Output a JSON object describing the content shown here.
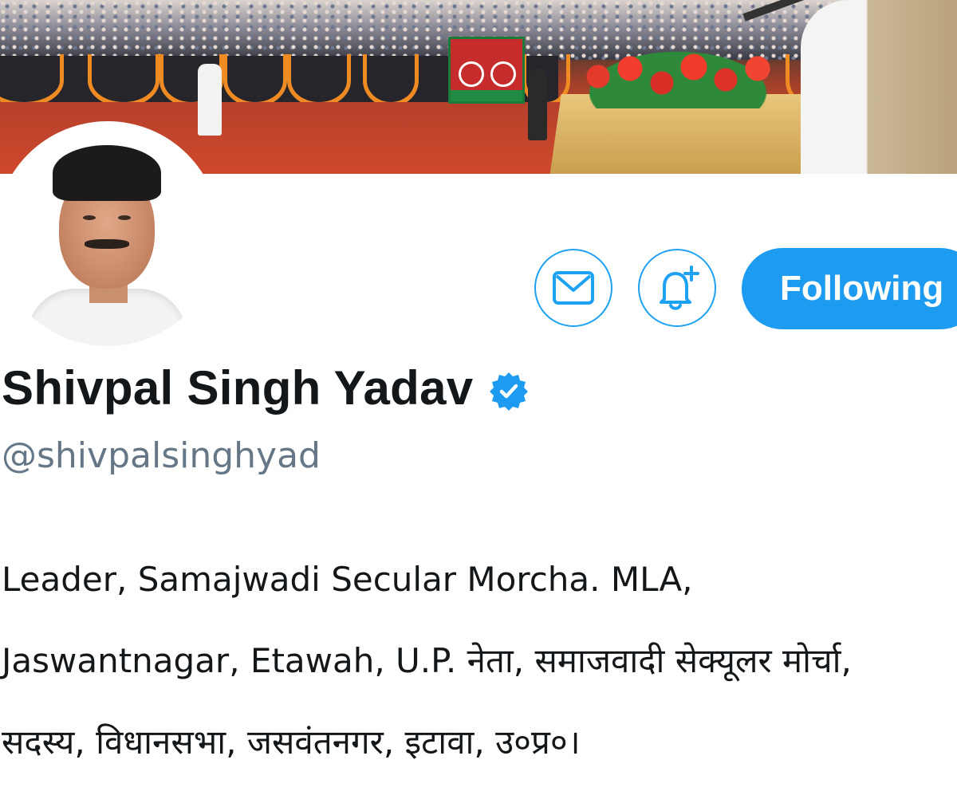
{
  "profile": {
    "name": "Shivpal Singh Yadav",
    "handle": "@shivpalsinghyad",
    "verified": true,
    "bio_lines": [
      "Leader, Samajwadi Secular Morcha. MLA,",
      "Jaswantnagar, Etawah, U.P.  नेता, समाजवादी सेक्यूलर मोर्चा,",
      "सदस्य, विधानसभा, जसवंतनगर, इटावा, उ०प्र०।"
    ]
  },
  "actions": {
    "message_icon": "envelope-icon",
    "notify_icon": "bell-plus-icon",
    "follow_label": "Following"
  },
  "colors": {
    "accent": "#1d9bf0",
    "text": "#14171a",
    "secondary_text": "#657786"
  }
}
